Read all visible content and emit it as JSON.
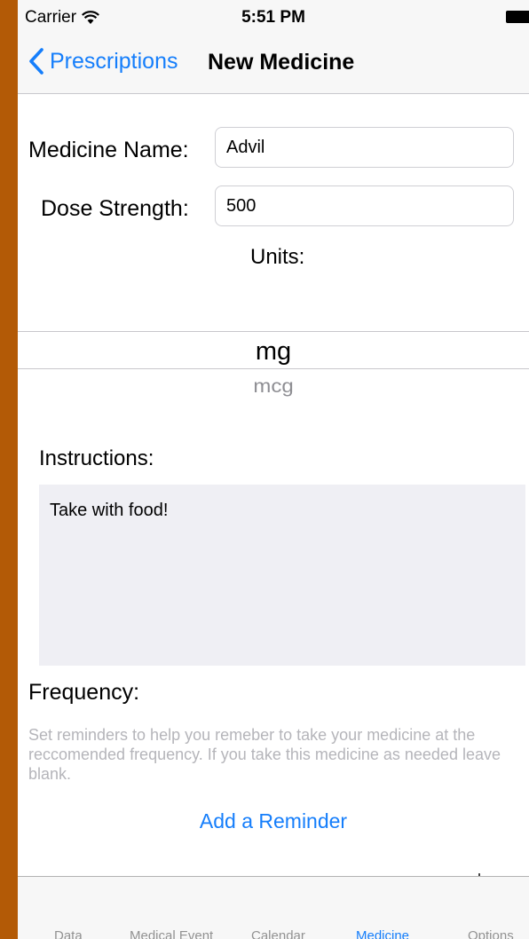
{
  "status_bar": {
    "carrier": "Carrier",
    "time": "5:51 PM"
  },
  "nav": {
    "back_label": "Prescriptions",
    "title": "New Medicine"
  },
  "form": {
    "medicine_name_label": "Medicine Name:",
    "medicine_name_value": "Advil",
    "dose_strength_label": "Dose Strength:",
    "dose_strength_value": "500",
    "units_label": "Units:",
    "units_selected": "mg",
    "units_next": "mcg",
    "instructions_label": "Instructions:",
    "instructions_value": "Take with food!",
    "frequency_label": "Frequency:",
    "frequency_help": "Set reminders to help you remeber to take your medicine at the reccomended frequency. If you take this medicine as needed leave blank.",
    "add_reminder_label": "Add a Reminder"
  },
  "tabs": [
    {
      "label": "Data",
      "active": false
    },
    {
      "label": "Medical Event",
      "active": false
    },
    {
      "label": "Calendar",
      "active": false
    },
    {
      "label": "Medicine",
      "active": true
    },
    {
      "label": "Options",
      "active": false
    }
  ],
  "colors": {
    "accent": "#157efb",
    "background_frame": "#b35a06",
    "instructions_bg": "#efeff4"
  }
}
